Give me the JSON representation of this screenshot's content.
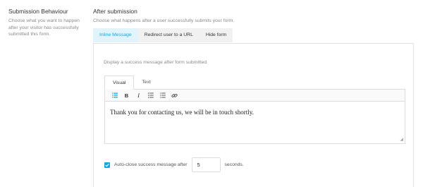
{
  "left": {
    "title": "Submission Behaviour",
    "description": "Choose what you want to happen after your visitor has successfully submitted this form."
  },
  "right": {
    "title": "After submission",
    "description": "Choose what happens after a user successfully submits your form.",
    "tabs": [
      {
        "label": "Inline Message",
        "active": true
      },
      {
        "label": "Redirect user to a URL",
        "active": false
      },
      {
        "label": "Hide form",
        "active": false
      }
    ]
  },
  "panel": {
    "description": "Display a success message after form submitted",
    "editor_tabs": [
      {
        "label": "Visual",
        "active": true
      },
      {
        "label": "Text",
        "active": false
      }
    ],
    "toolbar": {
      "bold": "B",
      "italic": "I",
      "icons": [
        "paragraph-icon",
        "bold-icon",
        "italic-icon",
        "bullet-list-icon",
        "numbered-list-icon",
        "link-icon"
      ]
    },
    "editor_content": "Thank you for contacting us, we will be in touch shortly.",
    "autoclose": {
      "checked": true,
      "label": "Auto-close success message after",
      "value": "5",
      "suffix": "seconds."
    }
  },
  "colors": {
    "accent": "#17a8e3",
    "active_tab_bg": "#e1f3fb",
    "tab_bg": "#f1f1f1",
    "border": "#e2e2e2"
  }
}
